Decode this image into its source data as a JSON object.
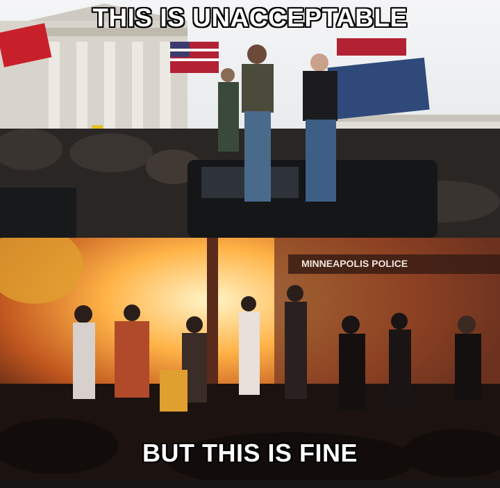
{
  "meme": {
    "top_caption": "THIS IS UNACCEPTABLE",
    "bottom_caption": "BUT THIS IS FINE",
    "sign_text": "MINNEAPOLIS POLICE"
  },
  "colors": {
    "sky": "#e9ecef",
    "building": "#d9d6d0",
    "crowd": "#2a2624",
    "fire": "#ffb347",
    "smoke": "#6b3a22"
  }
}
